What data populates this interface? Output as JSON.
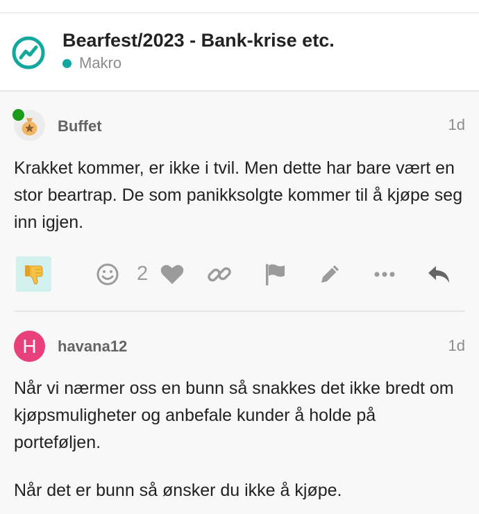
{
  "topic": {
    "title": "Bearfest/2023 - Bank-krise etc.",
    "category": "Makro",
    "category_color": "#12a89d"
  },
  "posts": [
    {
      "username": "Buffet",
      "age": "1d",
      "avatar": "money-bag-icon",
      "online": true,
      "paragraphs": [
        "Krakket kommer, er ikke i tvil. Men dette har bare vært en stor beartrap. De som panikksolgte kommer til å kjøpe seg inn igjen."
      ],
      "reaction": "thumbs-down-icon",
      "like_count": "2"
    },
    {
      "username": "havana12",
      "age": "1d",
      "avatar_letter": "H",
      "avatar_color": "#e8407a",
      "paragraphs": [
        "Når vi nærmer oss en bunn så snakkes det ikke bredt om kjøpsmuligheter og anbefale kunder å holde på porteføljen.",
        "Når det er bunn så ønsker du ikke å kjøpe."
      ]
    }
  ],
  "colors": {
    "accent": "#12a89d",
    "online": "#1a9c1a",
    "reaction_bg": "#d1f0ee",
    "muted": "#9b9b9b"
  }
}
